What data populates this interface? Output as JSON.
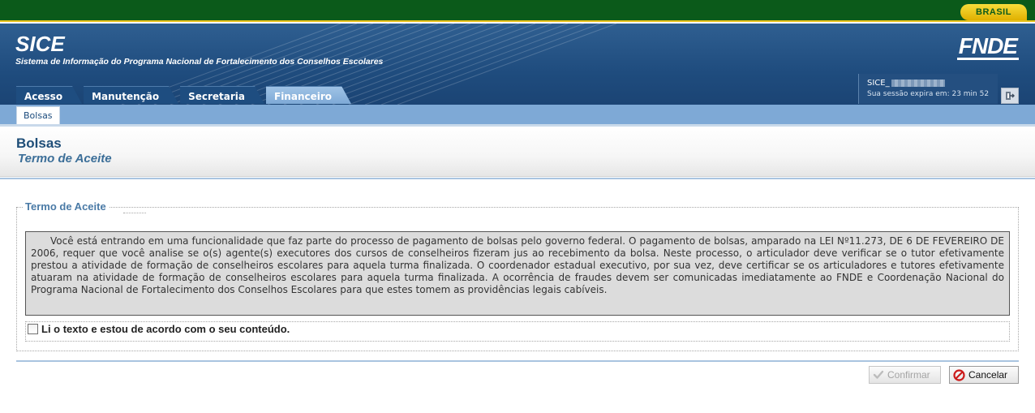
{
  "gov_bar": {
    "badge": "BRASIL"
  },
  "header": {
    "app_name": "SICE",
    "app_subtitle": "Sistema de Informação do Programa Nacional de Fortalecimento dos Conselhos Escolares",
    "logo": "FNDE"
  },
  "tabs": [
    {
      "label": "Acesso",
      "active": false
    },
    {
      "label": "Manutenção",
      "active": false
    },
    {
      "label": "Secretaria",
      "active": false
    },
    {
      "label": "Financeiro",
      "active": true
    }
  ],
  "user": {
    "username_prefix": "SICE_",
    "session_text": "Sua sessão expira em: 23 min 52",
    "logout_icon": "logout-icon"
  },
  "subnav": {
    "items": [
      {
        "label": "Bolsas",
        "active": true
      }
    ]
  },
  "page": {
    "title": "Bolsas",
    "subtitle": "Termo de Aceite"
  },
  "form": {
    "legend": "Termo de Aceite",
    "term_text": "Você está entrando em uma funcionalidade que faz parte do processo de pagamento de bolsas pelo governo federal. O pagamento de bolsas, amparado na LEI Nº11.273, DE 6 DE FEVEREIRO DE 2006, requer que você analise se o(s) agente(s) executores dos cursos de conselheiros fizeram jus ao recebimento da bolsa. Neste processo, o articulador deve verificar se o tutor efetivamente prestou a atividade de formação de conselheiros escolares para aquela turma finalizada. O coordenador estadual executivo, por sua vez, deve certificar se os articuladores e tutores efetivamente atuaram na atividade de formação de conselheiros escolares para aquela turma finalizada. A ocorrência de fraudes devem ser comunicadas imediatamente ao FNDE e Coordenação Nacional do Programa Nacional de Fortalecimento dos Conselhos Escolares para que estes tomem as providências legais cabíveis.",
    "agree_label": "Li o texto e estou de acordo com o seu conteúdo.",
    "agree_checked": false
  },
  "buttons": {
    "confirm_label": "Confirmar",
    "confirm_enabled": false,
    "cancel_label": "Cancelar"
  },
  "colors": {
    "gov_green": "#0b5a1a",
    "header_blue": "#1f4c7e",
    "accent_blue": "#7ea9d6",
    "title_blue": "#1f4e78",
    "cancel_red": "#cc1b1b"
  }
}
